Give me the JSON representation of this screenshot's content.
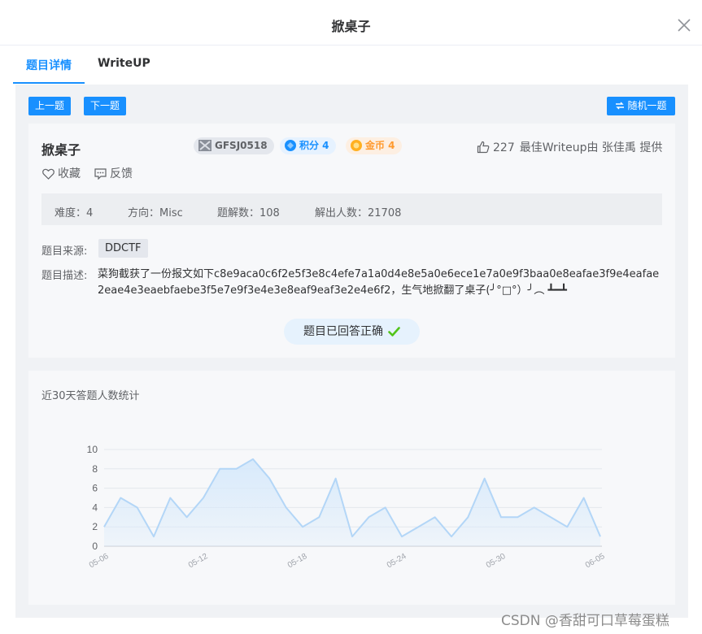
{
  "modal": {
    "title": "掀桌子"
  },
  "tabs": [
    {
      "label": "题目详情",
      "active": true
    },
    {
      "label": "WriteUP",
      "active": false
    }
  ],
  "nav": {
    "prev": "上一题",
    "next": "下一题",
    "random": "随机一题"
  },
  "problem": {
    "title": "掀桌子",
    "id": "GFSJ0518",
    "score": "积分 4",
    "coins": "金币 4",
    "likes": "227",
    "best_writeup": "最佳Writeup由 张佳禹 提供",
    "favorite": "收藏",
    "feedback": "反馈",
    "stats": {
      "difficulty": "难度：4",
      "direction": "方向：Misc",
      "solves": "题解数：108",
      "solvers": "解出人数：21708"
    },
    "source_label": "题目来源:",
    "source": "DDCTF",
    "desc_label": "题目描述:",
    "description": "菜狗截获了一份报文如下c8e9aca0c6f2e5f3e8c4efe7a1a0d4e8e5a0e6ece1e7a0e9f3baa0e8eafae3f9e4eafae2eae4e3eaebfaebe3f5e7e9f3e4e3e8eaf9eaf3e2e4e6f2，生气地掀翻了桌子(╯°□°）╯︵ ┻━┻",
    "answered": "题目已回答正确"
  },
  "colors": {
    "primary": "#1890ff",
    "success": "#52c41a",
    "coin": "#ff9a2e"
  },
  "icons": [
    "close-icon",
    "shuffle-icon",
    "flag-icon",
    "score-icon",
    "coin-icon",
    "thumbs-up-icon",
    "heart-icon",
    "feedback-icon",
    "check-icon"
  ],
  "chart_data": {
    "type": "area",
    "title": "近30天答题人数统计",
    "x": [
      "05-06",
      "05-07",
      "05-08",
      "05-09",
      "05-10",
      "05-11",
      "05-12",
      "05-13",
      "05-14",
      "05-15",
      "05-16",
      "05-17",
      "05-18",
      "05-19",
      "05-20",
      "05-21",
      "05-22",
      "05-23",
      "05-24",
      "05-25",
      "05-26",
      "05-27",
      "05-28",
      "05-29",
      "05-30",
      "05-31",
      "06-01",
      "06-02",
      "06-03",
      "06-04",
      "06-05"
    ],
    "xticks": [
      "05-06",
      "05-12",
      "05-18",
      "05-24",
      "05-30",
      "06-05"
    ],
    "values": [
      2,
      5,
      4,
      1,
      5,
      3,
      5,
      8,
      8,
      9,
      7,
      4,
      2,
      3,
      7,
      1,
      3,
      4,
      1,
      2,
      3,
      1,
      3,
      7,
      3,
      3,
      4,
      3,
      2,
      5,
      1
    ],
    "ylim": [
      0,
      10
    ],
    "yticks": [
      0,
      2,
      4,
      6,
      8,
      10
    ],
    "grid": true,
    "line_color": "#b3d6f7",
    "fill_color": "#d6e9fb"
  },
  "watermark": "CSDN @香甜可口草莓蛋糕"
}
